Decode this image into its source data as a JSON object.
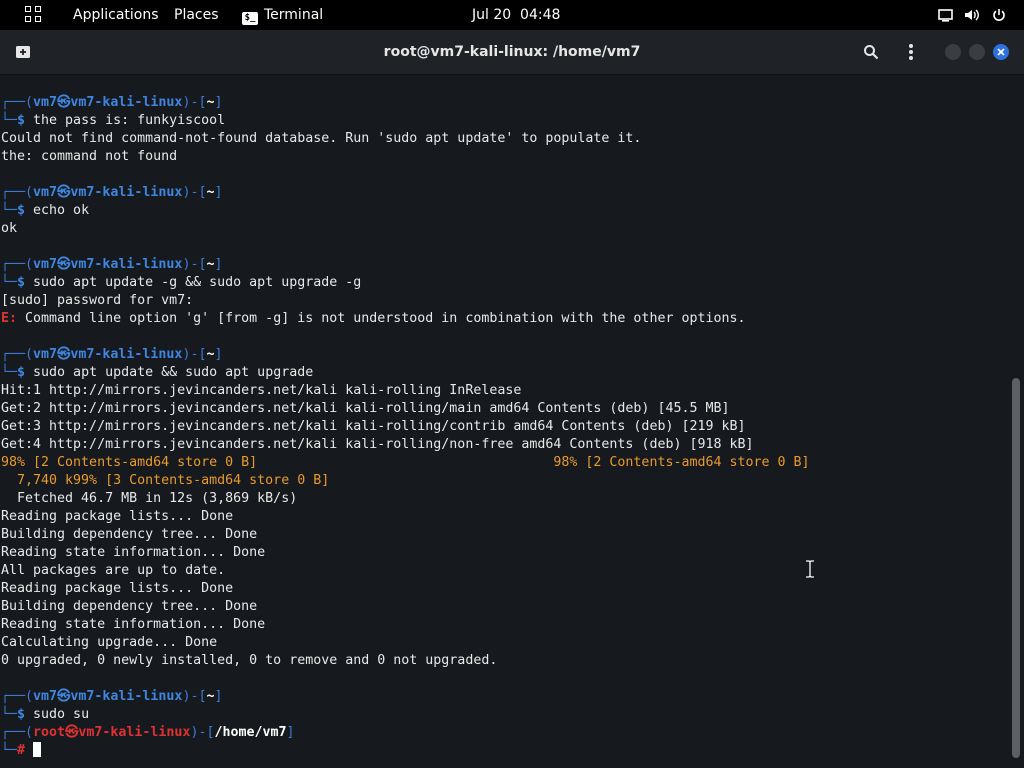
{
  "topbar": {
    "applications": "Applications",
    "places": "Places",
    "terminal": "Terminal",
    "clock": "Jul 20  04:48"
  },
  "window": {
    "title": "root@vm7-kali-linux: /home/vm7"
  },
  "prompt": {
    "user": "vm7",
    "host": "vm7-kali-linux",
    "dir": "~",
    "root_user": "root",
    "root_dir": "/home/vm7"
  },
  "terminal": {
    "cmd1": "the pass is: funkyiscool",
    "out1a": "Could not find command-not-found database. Run 'sudo apt update' to populate it.",
    "out1b": "the: command not found",
    "cmd2": "echo ok",
    "out2": "ok",
    "cmd3": "sudo apt update -g && sudo apt upgrade -g",
    "out3a": "[sudo] password for vm7:",
    "out3err_tag": "E:",
    "out3err": " Command line option 'g' [from -g] is not understood in combination with the other options.",
    "cmd4": "sudo apt update && sudo apt upgrade",
    "out4": [
      "Hit:1 http://mirrors.jevincanders.net/kali kali-rolling InRelease",
      "Get:2 http://mirrors.jevincanders.net/kali kali-rolling/main amd64 Contents (deb) [45.5 MB]",
      "Get:3 http://mirrors.jevincanders.net/kali kali-rolling/contrib amd64 Contents (deb) [219 kB]",
      "Get:4 http://mirrors.jevincanders.net/kali kali-rolling/non-free amd64 Contents (deb) [918 kB]"
    ],
    "progress1": "98% [2 Contents-amd64 store 0 B]                                     98% [2 Contents-amd64 store 0 B]",
    "progress2": "  7,740 k99% [3 Contents-amd64 store 0 B]",
    "out5": [
      "  Fetched 46.7 MB in 12s (3,869 kB/s)",
      "Reading package lists... Done",
      "Building dependency tree... Done",
      "Reading state information... Done",
      "All packages are up to date.",
      "Reading package lists... Done",
      "Building dependency tree... Done",
      "Reading state information... Done",
      "Calculating upgrade... Done",
      "0 upgraded, 0 newly installed, 0 to remove and 0 not upgraded."
    ],
    "cmd5": "sudo su"
  }
}
